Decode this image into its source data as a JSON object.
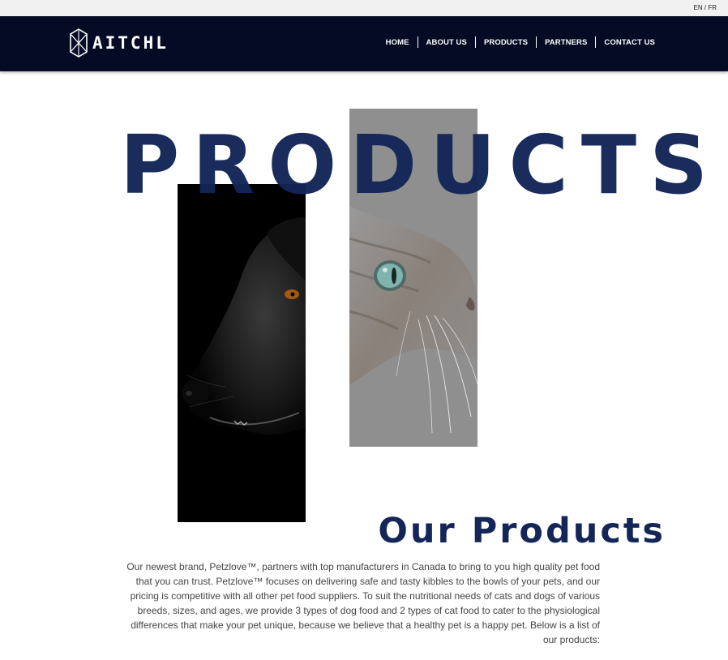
{
  "language_switch": "EN / FR",
  "brand": {
    "name": "AITCHL",
    "icon": "hexagon-logo-icon"
  },
  "nav": {
    "items": [
      {
        "label": "HOME"
      },
      {
        "label": "ABOUT US"
      },
      {
        "label": "PRODUCTS"
      },
      {
        "label": "PARTNERS"
      },
      {
        "label": "CONTACT US"
      }
    ]
  },
  "hero": {
    "title": "PRODUCTS"
  },
  "section": {
    "title": "Our Products",
    "intro": "Our newest brand, Petzlove™, partners with top manufacturers in Canada to bring to you high quality pet food that you can trust. Petzlove™ focuses on delivering safe and tasty kibbles to the bowls of your pets, and our pricing is competitive with all other pet food suppliers. To suit the nutritional needs of cats and dogs of various breeds, sizes, and ages, we provide 3 types of dog food and 2 types of cat food to cater to the physiological differences that make your pet unique, because we believe that a healthy pet is a happy pet. Below is a list of our products:"
  },
  "colors": {
    "navbar": "#050b24",
    "accent": "#132657",
    "topbar": "#f1f1f1"
  }
}
